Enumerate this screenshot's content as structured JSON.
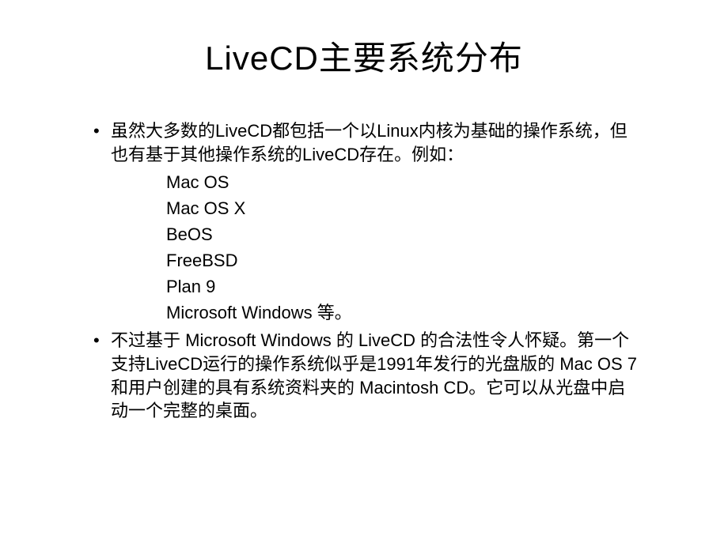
{
  "slide": {
    "title": "LiveCD主要系统分布",
    "bullet1": "虽然大多数的LiveCD都包括一个以Linux内核为基础的操作系统，但也有基于其他操作系统的LiveCD存在。例如：",
    "systems": {
      "item1": "Mac OS",
      "item2": "Mac OS X",
      "item3": "BeOS",
      "item4": "FreeBSD",
      "item5": "Plan 9",
      "item6": "Microsoft Windows 等。"
    },
    "bullet2": "不过基于 Microsoft Windows 的 LiveCD 的合法性令人怀疑。第一个支持LiveCD运行的操作系统似乎是1991年发行的光盘版的 Mac OS 7 和用户创建的具有系统资料夹的 Macintosh CD。它可以从光盘中启动一个完整的桌面。"
  }
}
